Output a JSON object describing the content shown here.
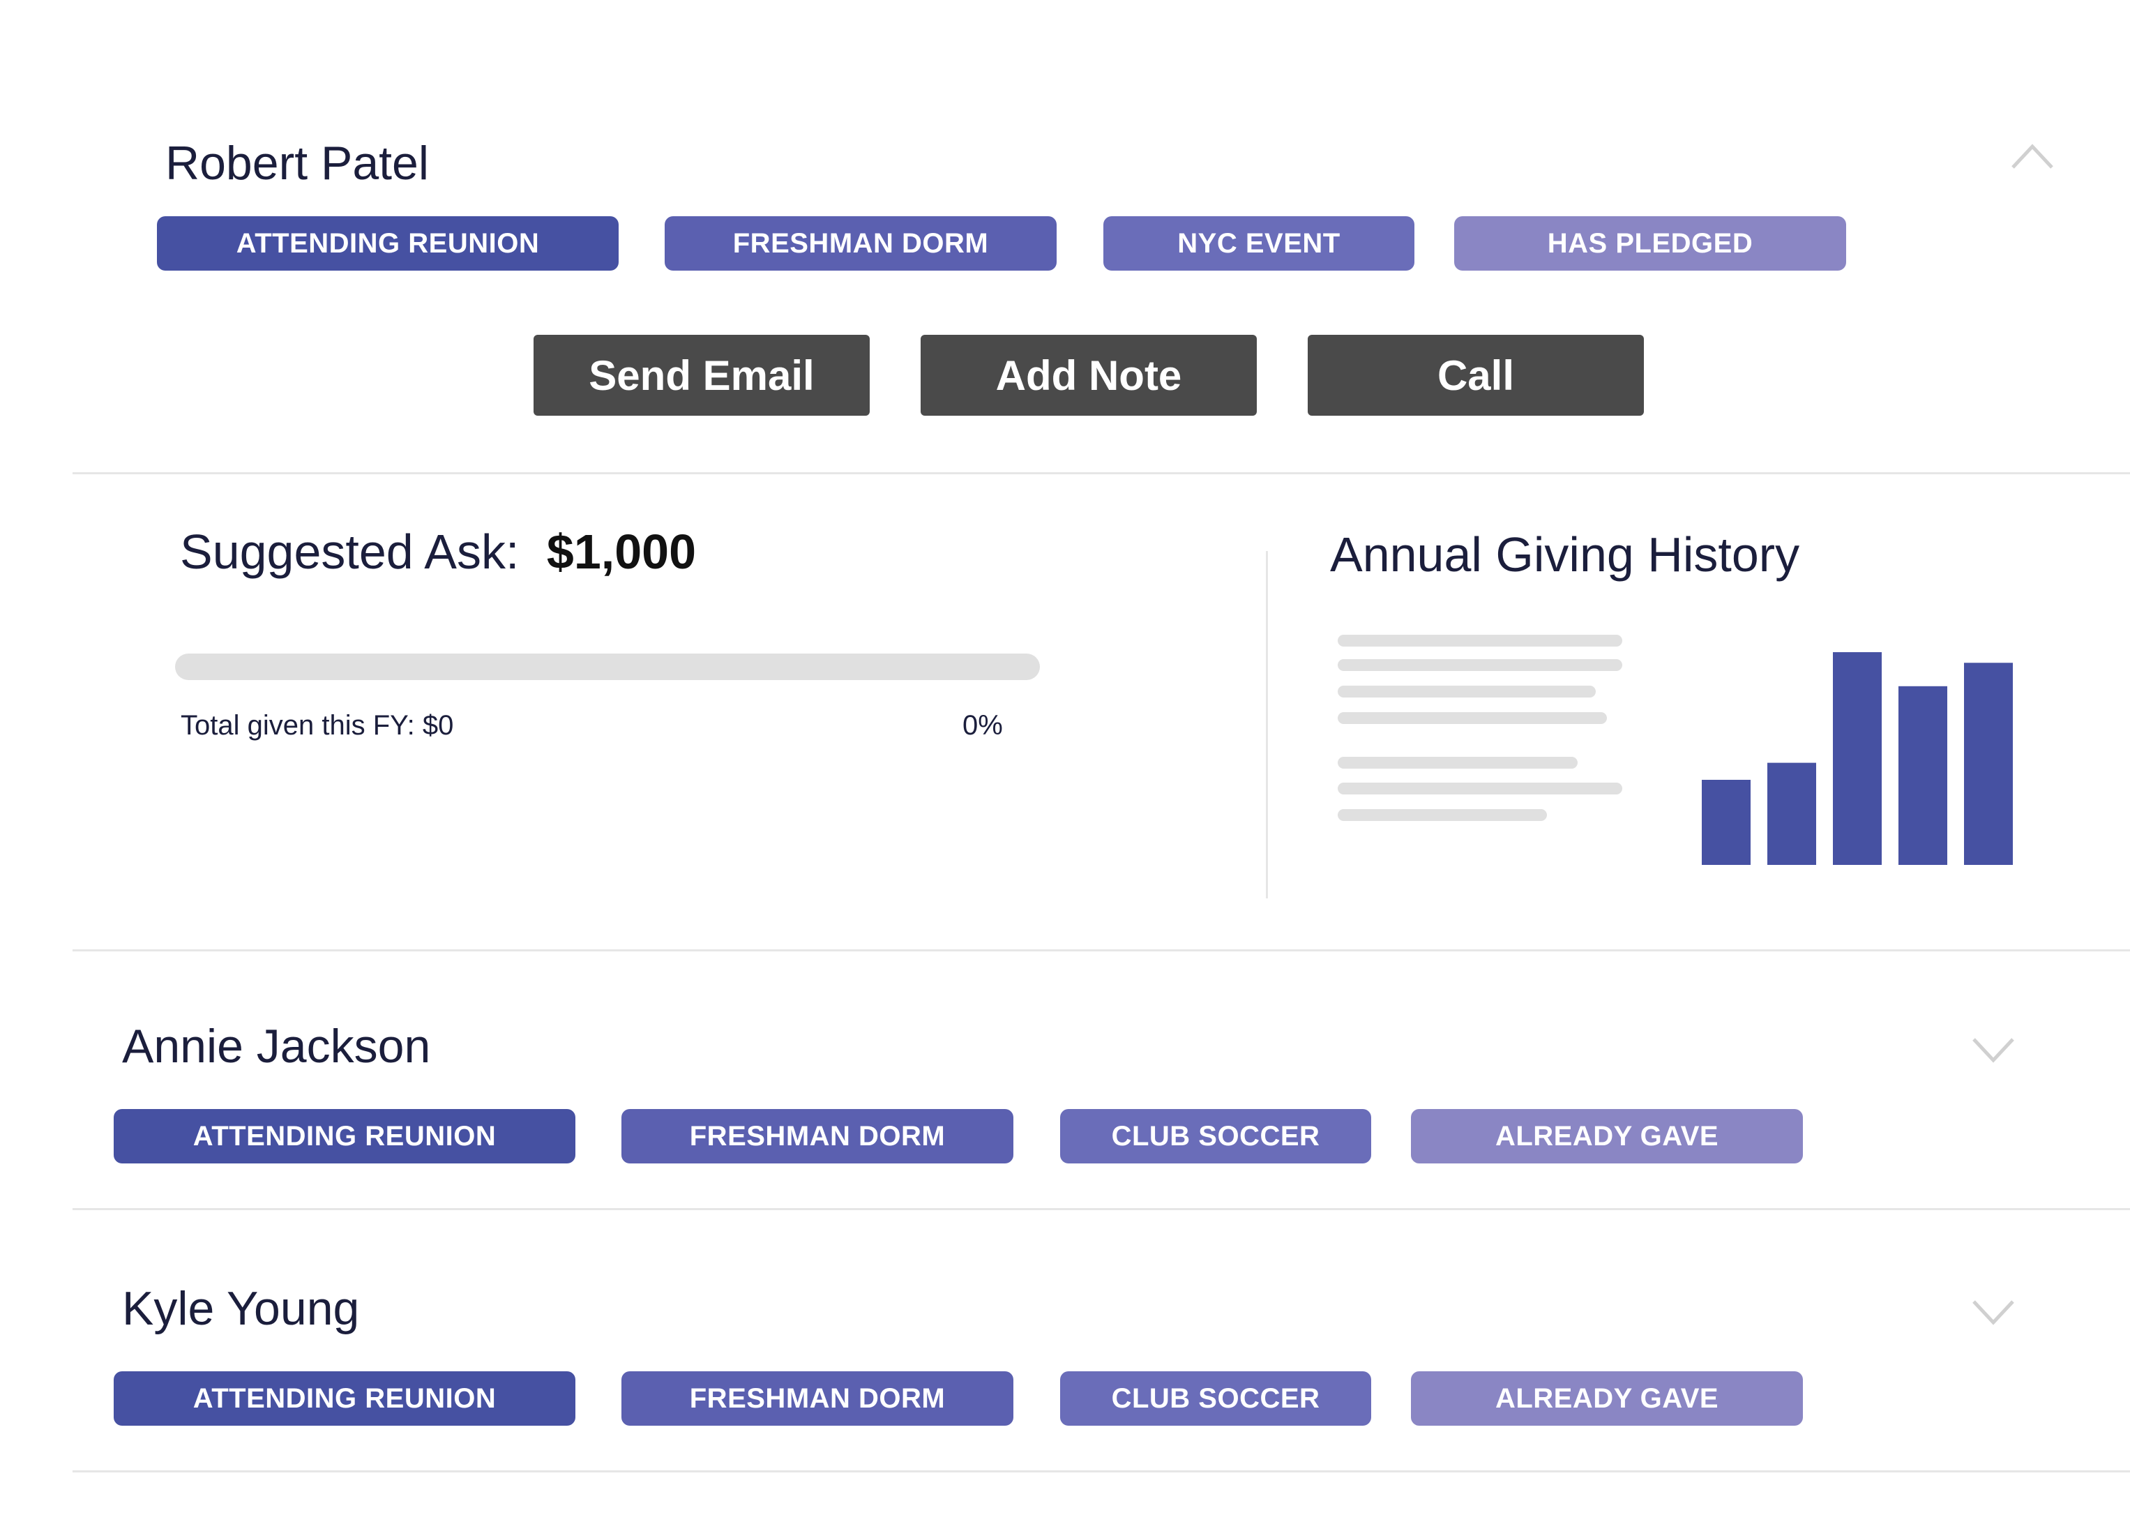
{
  "colors": {
    "tag_1": "#4651a2",
    "tag_2": "#5b60b0",
    "tag_3": "#6a6db9",
    "tag_4": "#8a86c4",
    "button_bg": "#4a4a4a",
    "bar": "#4651a2"
  },
  "donors": [
    {
      "name": "Robert Patel",
      "expanded": true,
      "toggle_icon": "chevron-up-icon",
      "tags": [
        "ATTENDING REUNION",
        "FRESHMAN DORM",
        "NYC EVENT",
        "HAS PLEDGED"
      ],
      "actions": {
        "email": "Send Email",
        "note": "Add Note",
        "call": "Call"
      },
      "suggested_ask": {
        "label": "Suggested Ask:",
        "amount": "$1,000"
      },
      "progress": {
        "fraction": 0,
        "total_label": "Total given this FY: $0",
        "percent_label": "0%"
      },
      "history": {
        "title": "Annual Giving History"
      }
    },
    {
      "name": "Annie Jackson",
      "expanded": false,
      "toggle_icon": "chevron-down-icon",
      "tags": [
        "ATTENDING REUNION",
        "FRESHMAN DORM",
        "CLUB SOCCER",
        "ALREADY GAVE"
      ]
    },
    {
      "name": "Kyle Young",
      "expanded": false,
      "toggle_icon": "chevron-down-icon",
      "tags": [
        "ATTENDING REUNION",
        "FRESHMAN DORM",
        "CLUB SOCCER",
        "ALREADY GAVE"
      ]
    }
  ],
  "chart_data": {
    "type": "bar",
    "title": "Annual Giving History",
    "categories": [
      "",
      "",
      "",
      "",
      ""
    ],
    "values": [
      40,
      48,
      100,
      84,
      95
    ],
    "ylim": [
      0,
      100
    ],
    "grid": false,
    "xlabel": "",
    "ylabel": ""
  }
}
